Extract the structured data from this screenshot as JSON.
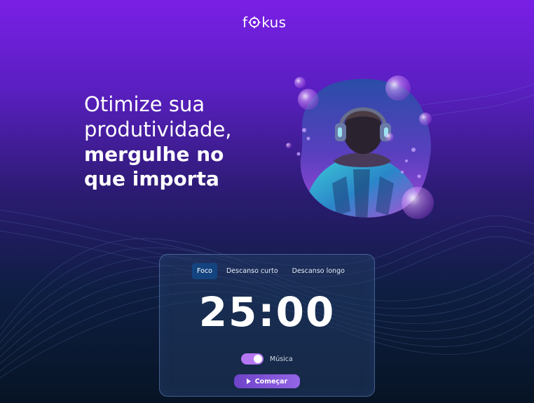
{
  "header": {
    "logo": {
      "part1": "f",
      "part2": "kus"
    }
  },
  "hero": {
    "line1": "Otimize sua",
    "line2": "produtividade,",
    "line3": "mergulhe no",
    "line4": "que importa"
  },
  "timer_card": {
    "tabs": [
      {
        "label": "Foco",
        "active": true
      },
      {
        "label": "Descanso curto",
        "active": false
      },
      {
        "label": "Descanso longo",
        "active": false
      }
    ],
    "time": "25:00",
    "music": {
      "label": "Música",
      "enabled": true
    },
    "start_button": {
      "label": "Começar",
      "icon": "play-icon"
    }
  },
  "colors": {
    "accent": "#9364e6",
    "tab_active": "#144480",
    "toggle_on": "#b677f2"
  }
}
